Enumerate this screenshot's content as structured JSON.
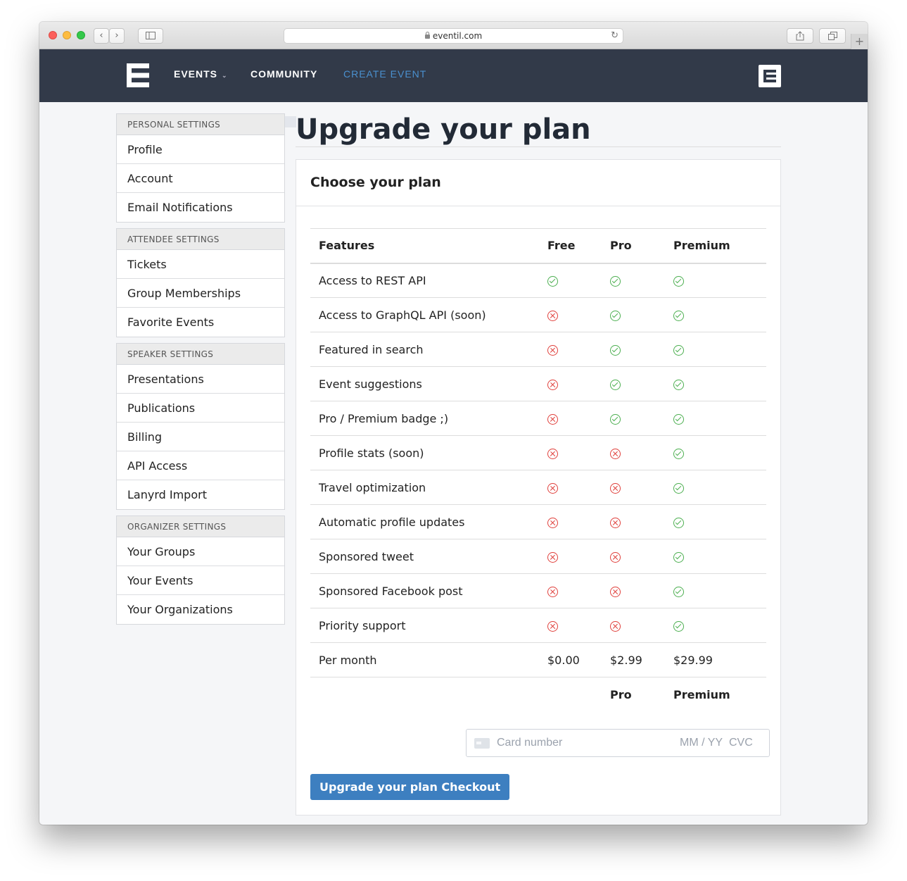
{
  "browser": {
    "url": "eventil.com",
    "back_icon": "‹",
    "forward_icon": "›",
    "reload_icon": "↻",
    "new_tab_icon": "+"
  },
  "nav": {
    "events": "EVENTS",
    "community": "COMMUNITY",
    "create_event": "CREATE EVENT",
    "accent_color": "#4a90cf"
  },
  "sidebar": {
    "groups": [
      {
        "heading": "PERSONAL SETTINGS",
        "items": [
          "Profile",
          "Account",
          "Email Notifications"
        ]
      },
      {
        "heading": "ATTENDEE SETTINGS",
        "items": [
          "Tickets",
          "Group Memberships",
          "Favorite Events"
        ]
      },
      {
        "heading": "SPEAKER SETTINGS",
        "items": [
          "Presentations",
          "Publications",
          "Billing",
          "API Access",
          "Lanyrd Import"
        ]
      },
      {
        "heading": "ORGANIZER SETTINGS",
        "items": [
          "Your Groups",
          "Your Events",
          "Your Organizations"
        ]
      }
    ]
  },
  "main": {
    "title": "Upgrade your plan",
    "card_title": "Choose your plan",
    "table": {
      "headers": [
        "Features",
        "Free",
        "Pro",
        "Premium"
      ],
      "rows": [
        {
          "feature": "Access to REST API",
          "free": true,
          "pro": true,
          "premium": true
        },
        {
          "feature": "Access to GraphQL API (soon)",
          "free": false,
          "pro": true,
          "premium": true
        },
        {
          "feature": "Featured in search",
          "free": false,
          "pro": true,
          "premium": true
        },
        {
          "feature": "Event suggestions",
          "free": false,
          "pro": true,
          "premium": true
        },
        {
          "feature": "Pro / Premium badge ;)",
          "free": false,
          "pro": true,
          "premium": true
        },
        {
          "feature": "Profile stats (soon)",
          "free": false,
          "pro": false,
          "premium": true
        },
        {
          "feature": "Travel optimization",
          "free": false,
          "pro": false,
          "premium": true
        },
        {
          "feature": "Automatic profile updates",
          "free": false,
          "pro": false,
          "premium": true
        },
        {
          "feature": "Sponsored tweet",
          "free": false,
          "pro": false,
          "premium": true
        },
        {
          "feature": "Sponsored Facebook post",
          "free": false,
          "pro": false,
          "premium": true
        },
        {
          "feature": "Priority support",
          "free": false,
          "pro": false,
          "premium": true
        }
      ],
      "price_row": {
        "label": "Per month",
        "free": "$0.00",
        "pro": "$2.99",
        "premium": "$29.99"
      },
      "select_row": {
        "pro": "Pro",
        "premium": "Premium"
      }
    },
    "card_input": {
      "placeholder": "Card number",
      "expiry_placeholder": "MM / YY",
      "cvc_placeholder": "CVC"
    },
    "checkout_label": "Upgrade your plan Checkout",
    "checkout_color": "#3d7fc0"
  }
}
